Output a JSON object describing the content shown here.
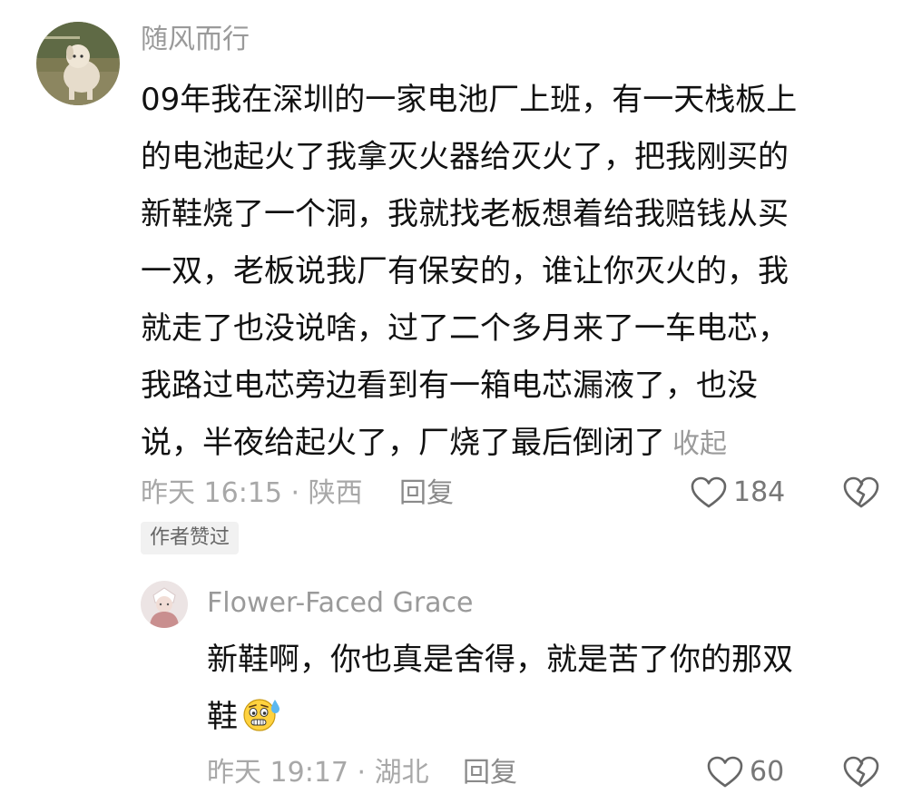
{
  "comments": [
    {
      "username": "随风而行",
      "lines": [
        "09年我在深圳的一家电池厂上班，有一天栈板上",
        "的电池起火了我拿灭火器给灭火了，把我刚买的",
        "新鞋烧了一个洞，我就找老板想着给我赔钱从买",
        "一双，老板说我厂有保安的，谁让你灭火的，我",
        "就走了也没说啥，过了二个多月来了一车电芯，",
        "我路过电芯旁边看到有一箱电芯漏液了，也没",
        "说，半夜给起火了，厂烧了最后倒闭了"
      ],
      "collapse_label": "收起",
      "time_location": "昨天 16:15 · 陕西",
      "reply_label": "回复",
      "like_count": "184",
      "badge": "作者赞过"
    },
    {
      "username": "Flower-Faced Grace",
      "lines": [
        "新鞋啊，你也真是舍得，就是苦了你的那双",
        "鞋"
      ],
      "time_location": "昨天 19:17 · 湖北",
      "reply_label": "回复",
      "like_count": "60"
    }
  ],
  "icons": {
    "like": "heart-outline-icon",
    "dislike": "broken-heart-icon",
    "emoji": "worried-sweat-emoji"
  },
  "colors": {
    "text_primary": "#111111",
    "text_secondary": "#9a9a9a",
    "badge_bg": "#f1f1f1"
  }
}
